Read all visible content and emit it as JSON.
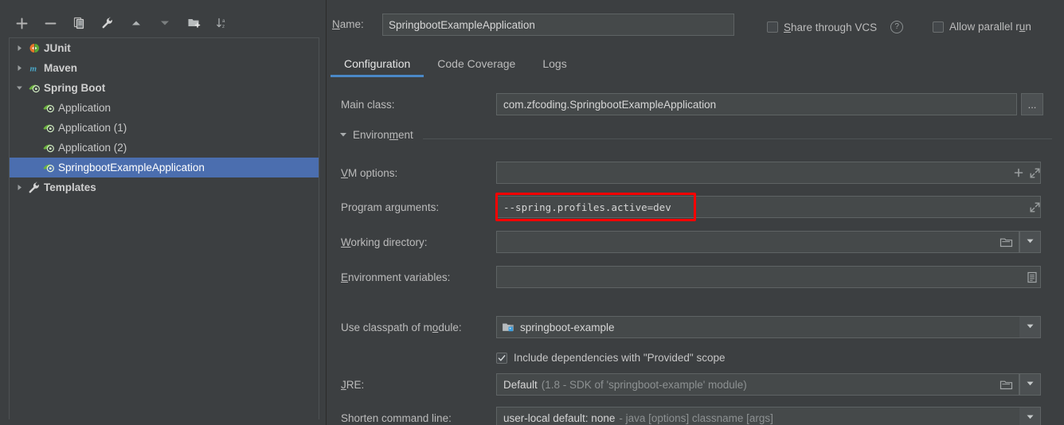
{
  "colors": {
    "background": "#3c3f41",
    "field_bg": "#45494a",
    "selection_blue": "#4b6eaf",
    "tab_underline": "#4a88c7",
    "annotation_red": "#fe0000",
    "text": "#bbbbbb",
    "muted_text": "#8d9192"
  },
  "toolbar": {
    "buttons": [
      {
        "name": "add-configuration-button",
        "icon": "plus-icon",
        "label": "+"
      },
      {
        "name": "remove-configuration-button",
        "icon": "minus-icon",
        "label": "−"
      },
      {
        "name": "copy-configuration-button",
        "icon": "copy-icon",
        "label": "Copy Configuration"
      },
      {
        "name": "edit-templates-button",
        "icon": "wrench-icon",
        "label": "Edit Templates"
      },
      {
        "name": "move-up-button",
        "icon": "arrow-up-icon",
        "label": "Move Up"
      },
      {
        "name": "move-down-button",
        "icon": "arrow-down-icon",
        "label": "Move Down"
      },
      {
        "name": "move-into-folder-button",
        "icon": "folder-add-icon",
        "label": "Move into new folder"
      },
      {
        "name": "sort-configurations-button",
        "icon": "sort-alpha-icon",
        "label": "Sort Configurations"
      }
    ]
  },
  "tree": {
    "nodes": [
      {
        "label": "JUnit",
        "icon": "junit-icon",
        "level": 0,
        "expanded": false,
        "has_twisty": true,
        "selected": false
      },
      {
        "label": "Maven",
        "icon": "maven-icon",
        "level": 0,
        "expanded": false,
        "has_twisty": true,
        "selected": false
      },
      {
        "label": "Spring Boot",
        "icon": "spring-boot-icon",
        "level": 0,
        "expanded": true,
        "has_twisty": true,
        "selected": false
      },
      {
        "label": "Application",
        "icon": "spring-boot-icon",
        "level": 1,
        "expanded": false,
        "has_twisty": false,
        "selected": false
      },
      {
        "label": "Application (1)",
        "icon": "spring-boot-icon",
        "level": 1,
        "expanded": false,
        "has_twisty": false,
        "selected": false
      },
      {
        "label": "Application (2)",
        "icon": "spring-boot-icon",
        "level": 1,
        "expanded": false,
        "has_twisty": false,
        "selected": false
      },
      {
        "label": "SpringbootExampleApplication",
        "icon": "spring-boot-icon",
        "level": 1,
        "expanded": false,
        "has_twisty": false,
        "selected": true
      },
      {
        "label": "Templates",
        "icon": "wrench-icon",
        "level": 0,
        "expanded": false,
        "has_twisty": true,
        "selected": false
      }
    ]
  },
  "header": {
    "name_label": "Name:",
    "name_label_mnemonic": "N",
    "name_value": "SpringbootExampleApplication",
    "share_through_vcs": {
      "label": "Share through VCS",
      "mnemonic": "S",
      "checked": false
    },
    "help_icon_label": "?",
    "allow_parallel_run": {
      "label": "Allow parallel run",
      "mnemonic": "u",
      "checked": false
    }
  },
  "tabs": [
    {
      "label": "Configuration",
      "active": true
    },
    {
      "label": "Code Coverage",
      "active": false
    },
    {
      "label": "Logs",
      "active": false
    }
  ],
  "form": {
    "main_class": {
      "label": "Main class:",
      "value": "com.zfcoding.SpringbootExampleApplication",
      "browse_button_label": "...",
      "browse_icon": "ellipsis-icon"
    },
    "environment_section": {
      "label": "Environment",
      "mnemonic": "m",
      "expanded": true,
      "collapse_icon": "chevron-down-icon"
    },
    "vm_options": {
      "label": "VM options:",
      "mnemonic": "V",
      "value": "",
      "icons": [
        "plus-icon",
        "expand-icon"
      ]
    },
    "program_arguments": {
      "label": "Program arguments:",
      "mnemonic": "g",
      "value": "--spring.profiles.active=dev",
      "icons": [
        "expand-icon"
      ],
      "highlighted": true
    },
    "working_directory": {
      "label": "Working directory:",
      "mnemonic": "W",
      "value": "",
      "icons": [
        "folder-icon",
        "chevron-down-icon"
      ]
    },
    "environment_variables": {
      "label": "Environment variables:",
      "mnemonic": "E",
      "value": "",
      "icons": [
        "list-icon"
      ]
    },
    "use_classpath_of_module": {
      "label": "Use classpath of module:",
      "mnemonic": "o",
      "value": "springboot-example",
      "value_icon": "module-icon",
      "icons": [
        "chevron-down-icon"
      ]
    },
    "include_provided_scope": {
      "label": "Include dependencies with \"Provided\" scope",
      "checked": true
    },
    "jre": {
      "label": "JRE:",
      "mnemonic": "J",
      "value": "Default",
      "value_hint": "(1.8 - SDK of 'springboot-example' module)",
      "icons": [
        "folder-icon",
        "chevron-down-icon"
      ]
    },
    "shorten_command_line": {
      "label": "Shorten command line:",
      "value": "user-local default: none",
      "value_hint": "- java [options] classname [args]",
      "icons": [
        "chevron-down-icon"
      ]
    }
  }
}
